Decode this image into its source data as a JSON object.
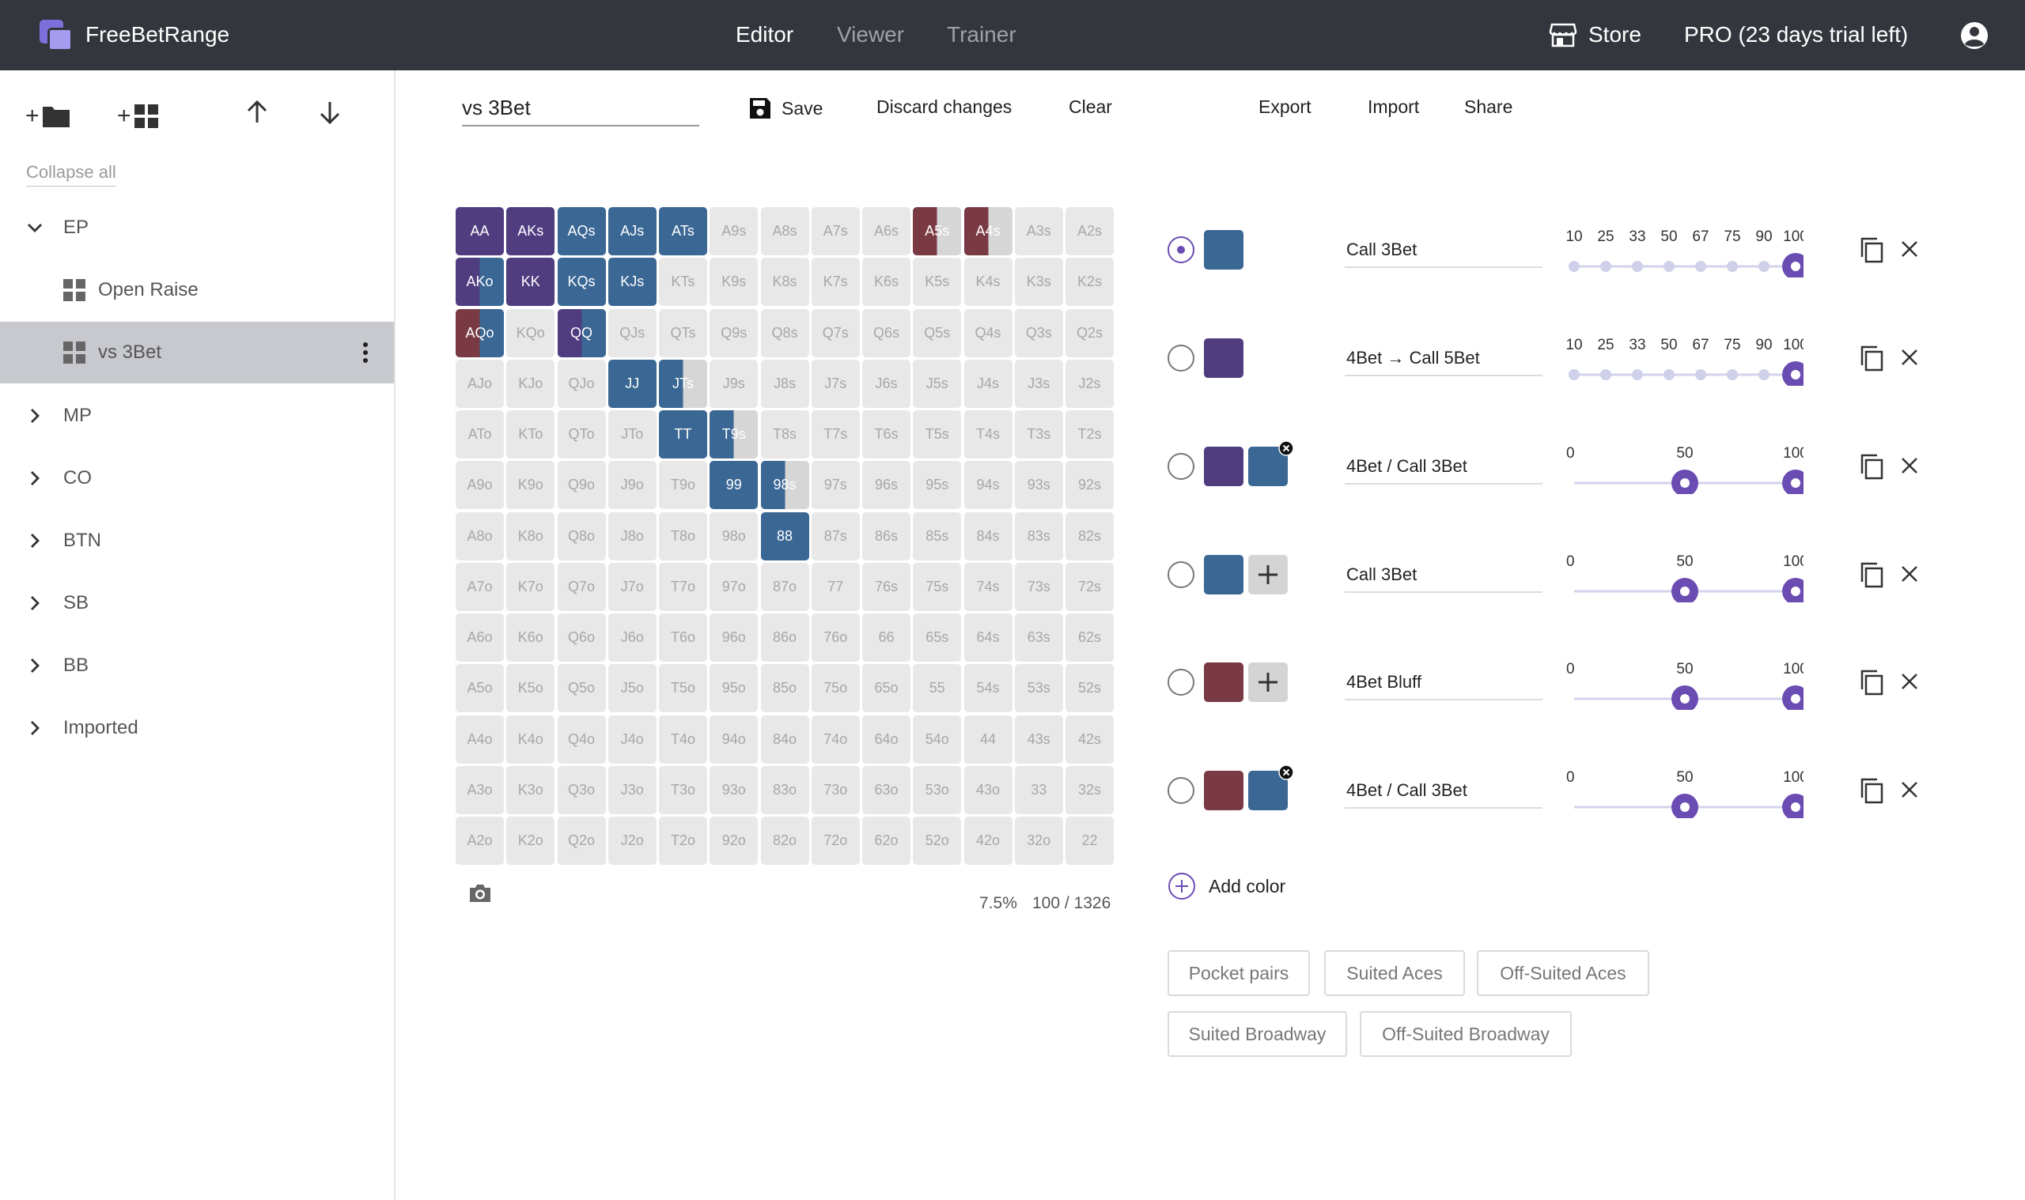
{
  "topbar": {
    "brand": "FreeBetRange",
    "tabs": [
      {
        "label": "Editor",
        "active": true
      },
      {
        "label": "Viewer",
        "active": false
      },
      {
        "label": "Trainer",
        "active": false
      }
    ],
    "store": "Store",
    "pro": "PRO (23 days trial left)"
  },
  "sidebar": {
    "add_folder_plus": "+",
    "add_range_plus": "+",
    "collapse_all": "Collapse all",
    "tree": [
      {
        "label": "EP",
        "type": "folder",
        "expanded": true
      },
      {
        "label": "Open Raise",
        "type": "range"
      },
      {
        "label": "vs 3Bet",
        "type": "range",
        "selected": true
      },
      {
        "label": "MP",
        "type": "folder"
      },
      {
        "label": "CO",
        "type": "folder"
      },
      {
        "label": "BTN",
        "type": "folder"
      },
      {
        "label": "SB",
        "type": "folder"
      },
      {
        "label": "BB",
        "type": "folder"
      },
      {
        "label": "Imported",
        "type": "folder"
      }
    ]
  },
  "editor": {
    "name_value": "vs 3Bet",
    "save": "Save",
    "discard": "Discard changes",
    "clear": "Clear",
    "export": "Export",
    "import": "Import",
    "share": "Share"
  },
  "colors": {
    "purple": "#4f3d80",
    "blue": "#3a6794",
    "maroon": "#7a3a44",
    "light": "#d6d6d6",
    "cell_bg": "#e8e8e8",
    "accent": "#6a4cb2"
  },
  "grid": {
    "cells": [
      [
        "AA",
        "AKs",
        "AQs",
        "AJs",
        "ATs",
        "A9s",
        "A8s",
        "A7s",
        "A6s",
        "A5s",
        "A4s",
        "A3s",
        "A2s"
      ],
      [
        "AKo",
        "KK",
        "KQs",
        "KJs",
        "KTs",
        "K9s",
        "K8s",
        "K7s",
        "K6s",
        "K5s",
        "K4s",
        "K3s",
        "K2s"
      ],
      [
        "AQo",
        "KQo",
        "QQ",
        "QJs",
        "QTs",
        "Q9s",
        "Q8s",
        "Q7s",
        "Q6s",
        "Q5s",
        "Q4s",
        "Q3s",
        "Q2s"
      ],
      [
        "AJo",
        "KJo",
        "QJo",
        "JJ",
        "JTs",
        "J9s",
        "J8s",
        "J7s",
        "J6s",
        "J5s",
        "J4s",
        "J3s",
        "J2s"
      ],
      [
        "ATo",
        "KTo",
        "QTo",
        "JTo",
        "TT",
        "T9s",
        "T8s",
        "T7s",
        "T6s",
        "T5s",
        "T4s",
        "T3s",
        "T2s"
      ],
      [
        "A9o",
        "K9o",
        "Q9o",
        "J9o",
        "T9o",
        "99",
        "98s",
        "97s",
        "96s",
        "95s",
        "94s",
        "93s",
        "92s"
      ],
      [
        "A8o",
        "K8o",
        "Q8o",
        "J8o",
        "T8o",
        "98o",
        "88",
        "87s",
        "86s",
        "85s",
        "84s",
        "83s",
        "82s"
      ],
      [
        "A7o",
        "K7o",
        "Q7o",
        "J7o",
        "T7o",
        "97o",
        "87o",
        "77",
        "76s",
        "75s",
        "74s",
        "73s",
        "72s"
      ],
      [
        "A6o",
        "K6o",
        "Q6o",
        "J6o",
        "T6o",
        "96o",
        "86o",
        "76o",
        "66",
        "65s",
        "64s",
        "63s",
        "62s"
      ],
      [
        "A5o",
        "K5o",
        "Q5o",
        "J5o",
        "T5o",
        "95o",
        "85o",
        "75o",
        "65o",
        "55",
        "54s",
        "53s",
        "52s"
      ],
      [
        "A4o",
        "K4o",
        "Q4o",
        "J4o",
        "T4o",
        "94o",
        "84o",
        "74o",
        "64o",
        "54o",
        "44",
        "43s",
        "42s"
      ],
      [
        "A3o",
        "K3o",
        "Q3o",
        "J3o",
        "T3o",
        "93o",
        "83o",
        "73o",
        "63o",
        "53o",
        "43o",
        "33",
        "32s"
      ],
      [
        "A2o",
        "K2o",
        "Q2o",
        "J2o",
        "T2o",
        "92o",
        "82o",
        "72o",
        "62o",
        "52o",
        "42o",
        "32o",
        "22"
      ]
    ],
    "colored": {
      "AA": [
        [
          "purple",
          1
        ]
      ],
      "AKs": [
        [
          "purple",
          1
        ]
      ],
      "AQs": [
        [
          "blue",
          1
        ]
      ],
      "AJs": [
        [
          "blue",
          1
        ]
      ],
      "ATs": [
        [
          "blue",
          1
        ]
      ],
      "A5s": [
        [
          "maroon",
          0.5
        ],
        [
          "light",
          0.5
        ]
      ],
      "A4s": [
        [
          "maroon",
          0.5
        ],
        [
          "light",
          0.5
        ]
      ],
      "AKo": [
        [
          "purple",
          0.5
        ],
        [
          "blue",
          0.5
        ]
      ],
      "KK": [
        [
          "purple",
          1
        ]
      ],
      "KQs": [
        [
          "blue",
          1
        ]
      ],
      "KJs": [
        [
          "blue",
          1
        ]
      ],
      "AQo": [
        [
          "maroon",
          0.5
        ],
        [
          "blue",
          0.5
        ]
      ],
      "QQ": [
        [
          "purple",
          0.5
        ],
        [
          "blue",
          0.5
        ]
      ],
      "JJ": [
        [
          "blue",
          1
        ]
      ],
      "JTs": [
        [
          "blue",
          0.5
        ],
        [
          "light",
          0.5
        ]
      ],
      "TT": [
        [
          "blue",
          1
        ]
      ],
      "T9s": [
        [
          "blue",
          0.5
        ],
        [
          "light",
          0.5
        ]
      ],
      "99": [
        [
          "blue",
          1
        ]
      ],
      "98s": [
        [
          "blue",
          0.5
        ],
        [
          "light",
          0.5
        ]
      ],
      "88": [
        [
          "blue",
          1
        ]
      ]
    },
    "percent": "7.5%",
    "combos": "100 / 1326"
  },
  "rows": [
    {
      "label": "Call 3Bet",
      "swatches": [
        "blue"
      ],
      "checked": true,
      "slider": "sizes",
      "sizes": [
        "10",
        "25",
        "33",
        "50",
        "67",
        "75",
        "90",
        "100"
      ],
      "value": 100
    },
    {
      "label": "4Bet → Call 5Bet",
      "swatches": [
        "purple"
      ],
      "checked": false,
      "slider": "sizes",
      "sizes": [
        "10",
        "25",
        "33",
        "50",
        "67",
        "75",
        "90",
        "100"
      ],
      "value": 100
    },
    {
      "label": "4Bet / Call 3Bet",
      "swatches": [
        "purple",
        "blue"
      ],
      "remove_badge": true,
      "checked": false,
      "slider": "range",
      "ticks": [
        "0",
        "50",
        "100"
      ],
      "values": [
        50,
        100
      ]
    },
    {
      "label": "Call 3Bet",
      "swatches": [
        "blue"
      ],
      "add_swatch": true,
      "checked": false,
      "slider": "range",
      "ticks": [
        "0",
        "50",
        "100"
      ],
      "values": [
        50,
        100
      ]
    },
    {
      "label": "4Bet Bluff",
      "swatches": [
        "maroon"
      ],
      "add_swatch": true,
      "checked": false,
      "slider": "range",
      "ticks": [
        "0",
        "50",
        "100"
      ],
      "values": [
        50,
        100
      ]
    },
    {
      "label": "4Bet / Call 3Bet",
      "swatches": [
        "maroon",
        "blue"
      ],
      "remove_badge": true,
      "checked": false,
      "slider": "range",
      "ticks": [
        "0",
        "50",
        "100"
      ],
      "values": [
        50,
        100
      ]
    }
  ],
  "add_color": "Add color",
  "presets": [
    "Pocket pairs",
    "Suited Aces",
    "Off-Suited Aces",
    "Suited Broadway",
    "Off-Suited Broadway"
  ]
}
